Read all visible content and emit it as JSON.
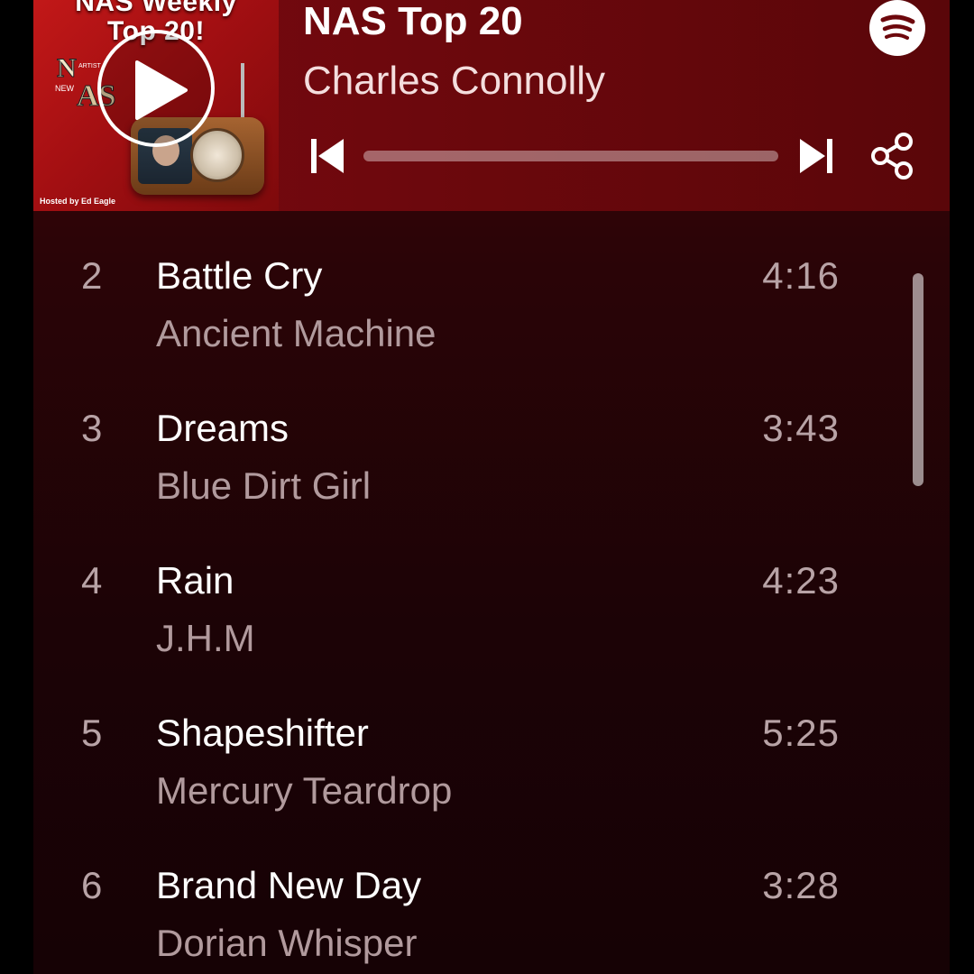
{
  "artwork": {
    "title_line1": "NAS Weekly",
    "title_line2": "Top 20!",
    "logo_n": "N",
    "logo_artist": "ARTIST",
    "logo_new": "NEW",
    "logo_as": "AS",
    "hosted_by": "Hosted by Ed Eagle"
  },
  "player": {
    "title": "NAS Top 20",
    "artist": "Charles Connolly",
    "progress": 0.0,
    "icons": {
      "play": "play-icon",
      "previous": "skip-previous-icon",
      "next": "skip-next-icon",
      "share": "share-icon",
      "brand": "spotify-icon"
    }
  },
  "tracks": [
    {
      "number": "2",
      "title": "Battle Cry",
      "artist": "Ancient Machine",
      "duration": "4:16"
    },
    {
      "number": "3",
      "title": "Dreams",
      "artist": "Blue Dirt Girl",
      "duration": "3:43"
    },
    {
      "number": "4",
      "title": "Rain",
      "artist": "J.H.M",
      "duration": "4:23"
    },
    {
      "number": "5",
      "title": "Shapeshifter",
      "artist": "Mercury Teardrop",
      "duration": "5:25"
    },
    {
      "number": "6",
      "title": "Brand New Day",
      "artist": "Dorian Whisper",
      "duration": "3:28"
    }
  ],
  "colors": {
    "header_bg": "#6d080d",
    "list_bg": "#1c0306",
    "accent": "#ffffff"
  }
}
